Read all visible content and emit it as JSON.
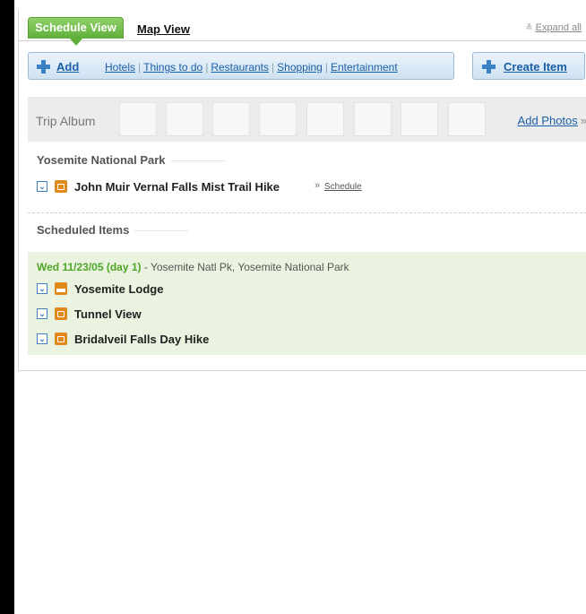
{
  "tabs": {
    "active": "Schedule View",
    "map": "Map View",
    "expand_all": "Expand all"
  },
  "add_bar": {
    "add_label": "Add",
    "links": [
      "Hotels",
      "Things to do",
      "Restaurants",
      "Shopping",
      "Entertainment"
    ],
    "separator": "|"
  },
  "create_item": "Create Item",
  "album": {
    "title": "Trip Album",
    "add_photos": "Add Photos",
    "arrow": "»"
  },
  "unscheduled": {
    "heading": "Yosemite National Park",
    "items": [
      {
        "label": "John Muir Vernal Falls Mist Trail Hike",
        "type": "camera",
        "arrow": "»",
        "action": "Schedule"
      }
    ]
  },
  "scheduled": {
    "heading": "Scheduled Items",
    "day": {
      "date": "Wed 11/23/05 (day 1)",
      "location": " - Yosemite Natl Pk, Yosemite National Park"
    },
    "items": [
      {
        "label": "Yosemite Lodge",
        "type": "hotel"
      },
      {
        "label": "Tunnel View",
        "type": "camera"
      },
      {
        "label": "Bridalveil Falls Day Hike",
        "type": "camera"
      }
    ]
  },
  "colors": {
    "accent_green": "#5fae3a",
    "link_blue": "#1a5ea8",
    "icon_orange": "#e08a1c",
    "day_background": "#eaf3df"
  }
}
